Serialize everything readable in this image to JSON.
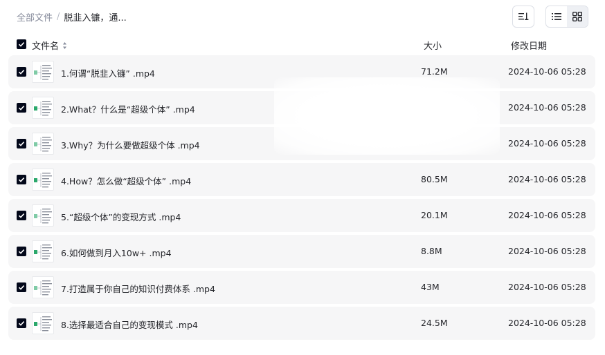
{
  "breadcrumb": {
    "root": "全部文件",
    "separator": "/",
    "current": "脱韭入镰，通..."
  },
  "toolbar": {
    "sort_icon": "sort-icon",
    "list_view_icon": "list-view-icon",
    "grid_view_icon": "grid-view-icon",
    "active_view": "list"
  },
  "table": {
    "headers": {
      "name": "文件名",
      "size": "大小",
      "date": "修改日期"
    },
    "rows": [
      {
        "name": "1.何谓“脱韭入镰” .mp4",
        "size": "71.2M",
        "date": "2024-10-06 05:28",
        "checked": true
      },
      {
        "name": "2.What？什么是“超级个体” .mp4",
        "size": "",
        "date": "2024-10-06 05:28",
        "checked": true
      },
      {
        "name": "3.Why？为什么要做超级个体 .mp4",
        "size": "",
        "date": "2024-10-06 05:28",
        "checked": true
      },
      {
        "name": "4.How？怎么做“超级个体” .mp4",
        "size": "80.5M",
        "date": "2024-10-06 05:28",
        "checked": true
      },
      {
        "name": "5.“超级个体”的变现方式 .mp4",
        "size": "20.1M",
        "date": "2024-10-06 05:28",
        "checked": true
      },
      {
        "name": "6.如何做到月入10w+ .mp4",
        "size": "8.8M",
        "date": "2024-10-06 05:28",
        "checked": true
      },
      {
        "name": "7.打造属于你自己的知识付费体系 .mp4",
        "size": "43M",
        "date": "2024-10-06 05:28",
        "checked": true
      },
      {
        "name": "8.选择最适合自己的变现模式 .mp4",
        "size": "24.5M",
        "date": "2024-10-06 05:28",
        "checked": true
      }
    ]
  },
  "colors": {
    "checkbox": "#03081a",
    "row_bg": "#f6f6f7",
    "muted_text": "#878c9c",
    "accent_thumb": "#2aa86b"
  }
}
